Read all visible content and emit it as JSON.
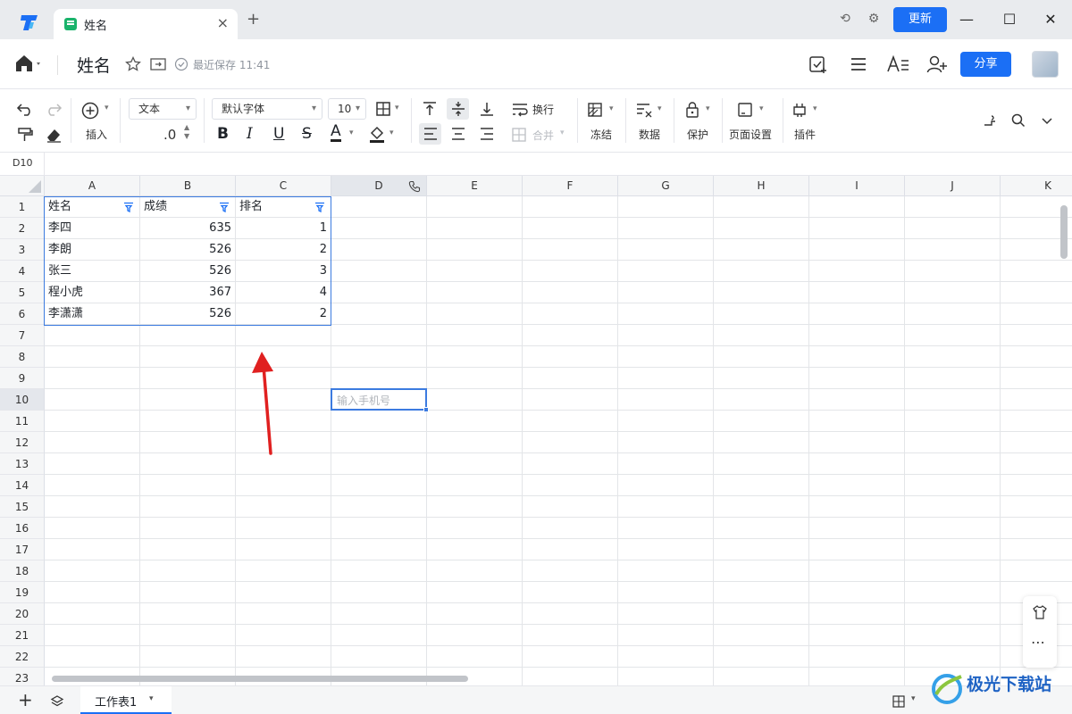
{
  "window": {
    "tab_title": "姓名",
    "tab_close": "×",
    "new_tab": "+",
    "update_label": "更新",
    "win_min": "—",
    "win_max": "☐",
    "win_close": "✕"
  },
  "doc": {
    "title": "姓名",
    "save_status": "最近保存 11:41",
    "share_label": "分享"
  },
  "toolbar": {
    "insert_label": "插入",
    "format_select": "文本",
    "decimal_label": ".0",
    "font_select": "默认字体",
    "size_select": "10",
    "wrap_label": "换行",
    "merge_label": "合并",
    "freeze_label": "冻结",
    "data_label": "数据",
    "protect_label": "保护",
    "page_setup_label": "页面设置",
    "plugin_label": "插件",
    "bold": "B",
    "italic": "I",
    "underline": "U",
    "strike": "S",
    "font_color": "A"
  },
  "formula_bar": {
    "cell_ref": "D10"
  },
  "grid": {
    "columns": [
      "A",
      "B",
      "C",
      "D",
      "E",
      "F",
      "G",
      "H",
      "I",
      "J",
      "K"
    ],
    "rows": [
      "1",
      "2",
      "3",
      "4",
      "5",
      "6",
      "7",
      "8",
      "9",
      "10",
      "11",
      "12",
      "13",
      "14",
      "15",
      "16",
      "17",
      "18",
      "19",
      "20",
      "21",
      "22",
      "23"
    ],
    "header_row": [
      "姓名",
      "成绩",
      "排名"
    ],
    "data": [
      [
        "李四",
        "635",
        "1"
      ],
      [
        "李朗",
        "526",
        "2"
      ],
      [
        "张三",
        "526",
        "3"
      ],
      [
        "程小虎",
        "367",
        "4"
      ],
      [
        "李潇潇",
        "526",
        "2"
      ]
    ],
    "active_cell_placeholder": "输入手机号"
  },
  "sheets": {
    "add": "+",
    "tab_label": "工作表1"
  },
  "watermark": "极光下载站",
  "colors": {
    "accent": "#1b6ff5",
    "selection": "#3c7be0",
    "arrow": "#e02020"
  }
}
